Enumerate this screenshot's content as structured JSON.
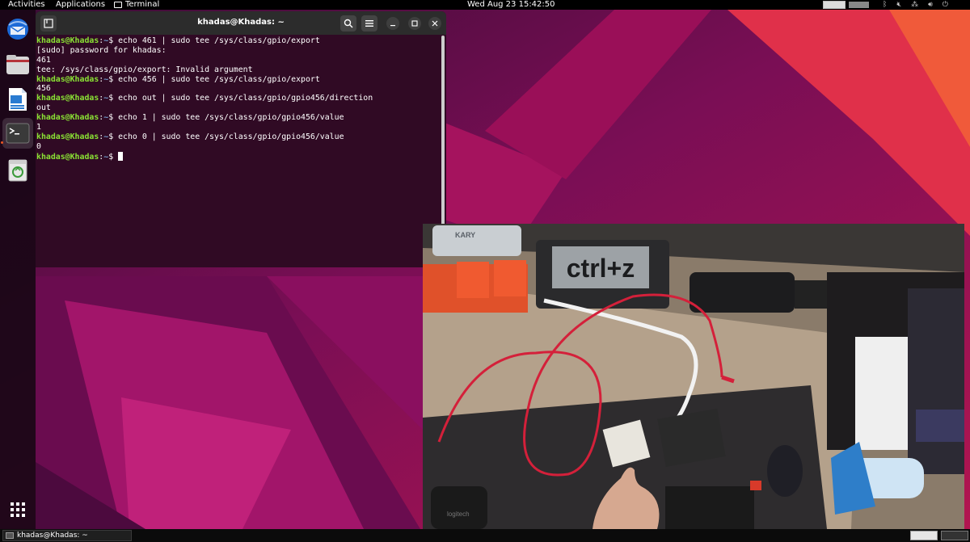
{
  "topbar": {
    "activities": "Activities",
    "applications": "Applications",
    "terminal": "Terminal",
    "clock": "Wed Aug 23  15:42:50",
    "tray_icons": [
      "bluetooth-icon",
      "volume-muted-icon",
      "network-icon",
      "volume-icon",
      "power-icon"
    ]
  },
  "dock": {
    "items": [
      "thunderbird-icon",
      "files-icon",
      "libreoffice-writer-icon",
      "terminal-icon",
      "trash-icon"
    ],
    "apps_button": "show-apps-icon"
  },
  "terminal": {
    "title": "khadas@Khadas: ~",
    "prompt_user": "khadas@Khadas",
    "prompt_sep": ":",
    "prompt_path": "~",
    "prompt_char": "$ ",
    "lines": [
      {
        "type": "cmd",
        "text": "echo 461 | sudo tee /sys/class/gpio/export"
      },
      {
        "type": "out",
        "text": "[sudo] password for khadas:"
      },
      {
        "type": "out",
        "text": "461"
      },
      {
        "type": "out",
        "text": "tee: /sys/class/gpio/export: Invalid argument"
      },
      {
        "type": "cmd",
        "text": "echo 456 | sudo tee /sys/class/gpio/export"
      },
      {
        "type": "out",
        "text": "456"
      },
      {
        "type": "cmd",
        "text": "echo out | sudo tee /sys/class/gpio/gpio456/direction"
      },
      {
        "type": "out",
        "text": "out"
      },
      {
        "type": "cmd",
        "text": "echo 1 | sudo tee /sys/class/gpio/gpio456/value"
      },
      {
        "type": "out",
        "text": "1"
      },
      {
        "type": "cmd",
        "text": "echo 0 | sudo tee /sys/class/gpio/gpio456/value"
      },
      {
        "type": "out",
        "text": "0"
      },
      {
        "type": "prompt",
        "text": ""
      }
    ]
  },
  "camera": {
    "sign_text": "ctrl+z",
    "brand_text": "KARY",
    "mouse_brand": "logitech"
  },
  "taskbar": {
    "window_label": "khadas@Khadas: ~"
  },
  "colors": {
    "terminal_bg": "#300a24",
    "prompt_user": "#8ae234",
    "prompt_path": "#729fcf",
    "accent": "#e95420"
  }
}
